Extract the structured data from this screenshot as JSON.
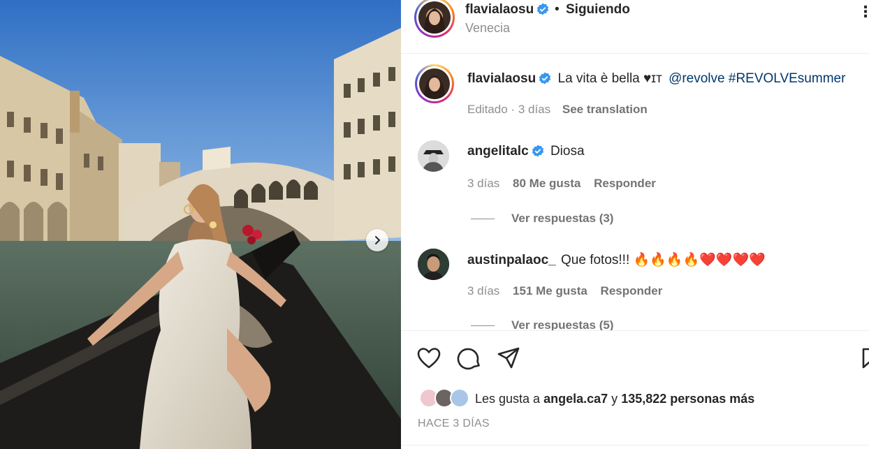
{
  "post": {
    "username": "flavialaosu",
    "follow_separator": "•",
    "follow_status": "Siguiendo",
    "location": "Venecia",
    "more_menu": "⋮"
  },
  "caption": {
    "username": "flavialaosu",
    "text": "La vita è bella ♥ɪᴛ",
    "mention": "@revolve",
    "hashtag": "#REVOLVEsummer",
    "edited": "Editado",
    "dot": "·",
    "time": "3 días",
    "translate": "See translation"
  },
  "comments": [
    {
      "username": "angelitalc",
      "verified": true,
      "text": "Diosa",
      "time": "3 días",
      "likes": "80 Me gusta",
      "reply": "Responder",
      "view_replies": "Ver respuestas (3)"
    },
    {
      "username": "austinpalaoc_",
      "verified": false,
      "text": "Que fotos!!! 🔥🔥🔥🔥❤️❤️❤️❤️",
      "time": "3 días",
      "likes": "151 Me gusta",
      "reply": "Responder",
      "view_replies": "Ver respuestas (5)"
    }
  ],
  "likes": {
    "prefix": "Les gusta a",
    "user": "angela.ca7",
    "connector": "y",
    "others": "135,822 personas más"
  },
  "timestamp": "HACE 3 DÍAS",
  "colors": {
    "verified": "#3897f0",
    "link": "#00376b",
    "secondary": "#8e8e8e"
  }
}
